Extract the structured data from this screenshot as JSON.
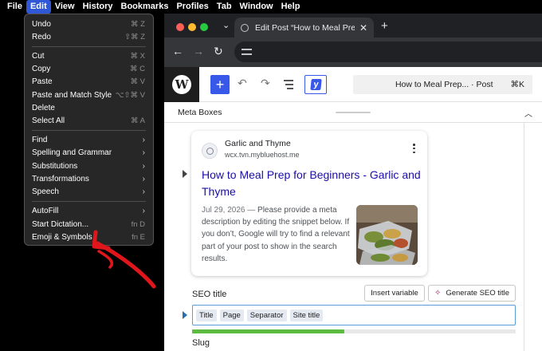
{
  "menubar": {
    "items": [
      "File",
      "Edit",
      "View",
      "History",
      "Bookmarks",
      "Profiles",
      "Tab",
      "Window",
      "Help"
    ],
    "active": "Edit"
  },
  "edit_menu": {
    "groups": [
      [
        {
          "label": "Undo",
          "shortcut": "⌘ Z"
        },
        {
          "label": "Redo",
          "shortcut": "⇧⌘ Z"
        }
      ],
      [
        {
          "label": "Cut",
          "shortcut": "⌘ X"
        },
        {
          "label": "Copy",
          "shortcut": "⌘ C"
        },
        {
          "label": "Paste",
          "shortcut": "⌘ V"
        },
        {
          "label": "Paste and Match Style",
          "shortcut": "⌥⇧⌘ V"
        },
        {
          "label": "Delete",
          "shortcut": ""
        },
        {
          "label": "Select All",
          "shortcut": "⌘ A"
        }
      ],
      [
        {
          "label": "Find",
          "submenu": true
        },
        {
          "label": "Spelling and Grammar",
          "submenu": true
        },
        {
          "label": "Substitutions",
          "submenu": true
        },
        {
          "label": "Transformations",
          "submenu": true
        },
        {
          "label": "Speech",
          "submenu": true
        }
      ],
      [
        {
          "label": "AutoFill",
          "submenu": true
        },
        {
          "label": "Start Dictation...",
          "shortcut": "fn D"
        },
        {
          "label": "Emoji & Symbols",
          "shortcut": "fn E"
        }
      ]
    ]
  },
  "browser": {
    "tab_title": "Edit Post “How to Meal Prep fo",
    "tab_close": "✕",
    "new_tab": "+",
    "back": "←",
    "forward": "→",
    "reload": "↻"
  },
  "editor": {
    "logo": "W",
    "add_block": "+",
    "undo": "↶",
    "redo": "↷",
    "command_title": "How to Meal Prep... · Post",
    "command_shortcut": "⌘K",
    "yoast_letter": "y"
  },
  "meta": {
    "label": "Meta Boxes",
    "caret": "︿"
  },
  "snippet": {
    "site_name": "Garlic and Thyme",
    "site_url": "wcx.tvn.mybluehost.me",
    "title": "How to Meal Prep for Beginners - Garlic and Thyme",
    "date": "Jul 29, 2026 —",
    "description": " Please provide a meta description by editing the snippet below. If you don’t, Google will try to find a relevant part of your post to show in the search results."
  },
  "seo": {
    "label": "SEO title",
    "insert_variable": "Insert variable",
    "generate_label": "Generate SEO title",
    "generate_icon": "✧",
    "variables": [
      "Title",
      "Page",
      "Separator",
      "Site title"
    ],
    "progress": 0.47,
    "slug_label": "Slug"
  },
  "colors": {
    "menu_highlight": "#2f57d6",
    "wp_blue": "#3858e9",
    "link": "#1a0dab",
    "progress": "#5dbb3f",
    "arrow": "#e0161b"
  }
}
